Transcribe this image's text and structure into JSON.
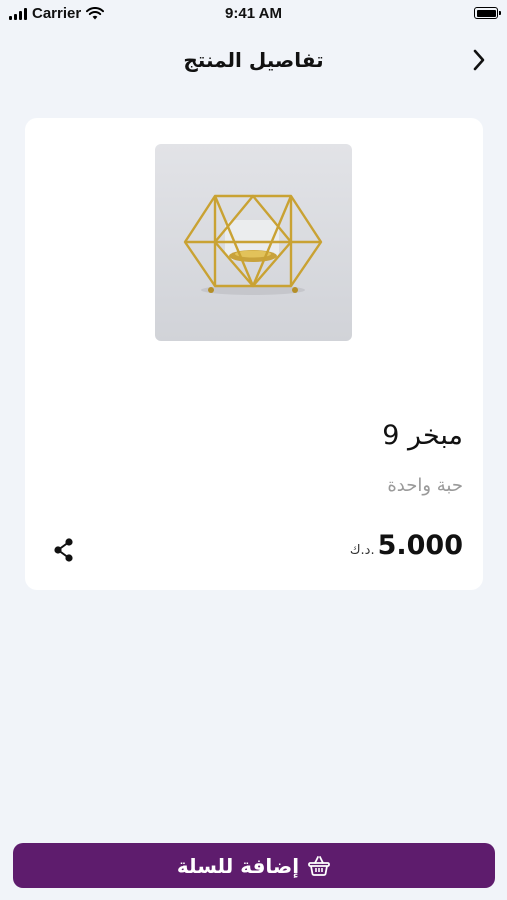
{
  "status_bar": {
    "carrier": "Carrier",
    "time": "9:41 AM"
  },
  "nav": {
    "title": "تفاصيل المنتج",
    "back_icon": "chevron-right-icon"
  },
  "product": {
    "image_alt": "gold geometric incense burner",
    "name": "مبخر 9",
    "unit": "حبة واحدة",
    "price": "5.000",
    "currency": "د.ك."
  },
  "actions": {
    "add_to_cart_label": "إضافة للسلة",
    "cart_icon": "basket-icon",
    "share_icon": "share-icon"
  },
  "colors": {
    "primary": "#5e1c6d",
    "background": "#f1f4f9",
    "card": "#ffffff"
  }
}
